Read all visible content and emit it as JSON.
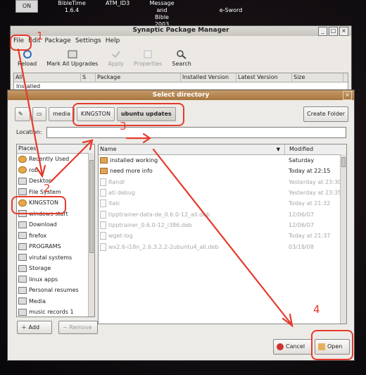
{
  "desktop": {
    "on_label": "ON",
    "icons": [
      "BibleTime 1.6.4",
      "ATM_ID3",
      "Message and Bible 2003",
      "e-Sword"
    ]
  },
  "synaptic": {
    "title": "Synaptic Package Manager",
    "menu": [
      "File",
      "Edit",
      "Package",
      "Settings",
      "Help"
    ],
    "toolbar": [
      "Reload",
      "Mark All Upgrades",
      "Apply",
      "Properties",
      "Search"
    ],
    "columns": [
      "S",
      "Package",
      "Installed Version",
      "Latest Version",
      "Size"
    ],
    "sidebar_row": "Installed"
  },
  "dialog": {
    "title": "Select directory",
    "path_buttons": [
      "media",
      "KINGSTON",
      "ubuntu updates"
    ],
    "create_folder": "Create Folder",
    "location_label": "Location:",
    "location_value": "",
    "places_header": "Places",
    "places": [
      "Recently Used",
      "rob",
      "Desktop",
      "File System",
      "KINGSTON",
      "windows start",
      "Download",
      "firefox",
      "PROGRAMS",
      "virutal systems",
      "Storage",
      "linux apps",
      "Personal resumes",
      "Media",
      "music records 1"
    ],
    "add_label": "Add",
    "remove_label": "Remove",
    "name_header": "Name",
    "modified_header": "Modified",
    "files": [
      {
        "name": "installed working",
        "modified": "Saturday",
        "kind": "folder",
        "dim": false
      },
      {
        "name": "need more info",
        "modified": "Today at 22:15",
        "kind": "folder",
        "dim": false
      },
      {
        "name": "Randr",
        "modified": "Yesterday at 23:30",
        "kind": "file",
        "dim": true
      },
      {
        "name": "ati debug",
        "modified": "Yesterday at 23:35",
        "kind": "file",
        "dim": true
      },
      {
        "name": "italc",
        "modified": "Today at 21:32",
        "kind": "file",
        "dim": true
      },
      {
        "name": "tipptrainer-data-de_0.6.0-12_all.deb",
        "modified": "12/06/07",
        "kind": "file",
        "dim": true
      },
      {
        "name": "tipptrainer_0.6.0-12_i386.deb",
        "modified": "12/06/07",
        "kind": "file",
        "dim": true
      },
      {
        "name": "wget-log",
        "modified": "Today at 21:37",
        "kind": "file",
        "dim": true
      },
      {
        "name": "wx2.6-i18n_2.6.3.2.2-2ubuntu4_all.deb",
        "modified": "03/18/08",
        "kind": "file",
        "dim": true
      }
    ],
    "cancel_label": "Cancel",
    "open_label": "Open"
  },
  "annotations": [
    "1",
    "2",
    "3",
    "4"
  ],
  "colors": {
    "annotation": "#e53a2b",
    "dialog_title": "#b1824b"
  }
}
